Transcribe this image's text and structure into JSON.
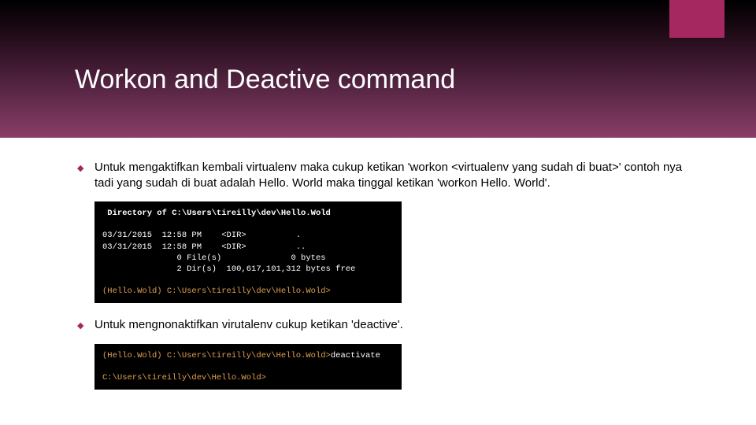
{
  "slide": {
    "title": "Workon and Deactive command"
  },
  "bullets": [
    {
      "text": "Untuk mengaktifkan kembali virtualenv maka cukup ketikan 'workon <virtualenv yang sudah di buat>' contoh nya tadi yang sudah di buat adalah Hello. World maka tinggal ketikan 'workon Hello. World'."
    },
    {
      "text": "Untuk mengnonaktifkan virutalenv cukup ketikan 'deactive'."
    }
  ],
  "terminal1": {
    "line1": " Directory of C:\\Users\\tireilly\\dev\\Hello.Wold",
    "line2": "03/31/2015  12:58 PM    <DIR>          .",
    "line3": "03/31/2015  12:58 PM    <DIR>          ..",
    "line4": "               0 File(s)              0 bytes",
    "line5": "               2 Dir(s)  100,617,101,312 bytes free",
    "prompt": "(Hello.Wold) C:\\Users\\tireilly\\dev\\Hello.Wold>"
  },
  "terminal2": {
    "line1_prompt": "(Hello.Wold) C:\\Users\\tireilly\\dev\\Hello.Wold>",
    "line1_cmd": "deactivate",
    "line2_prompt": "C:\\Users\\tireilly\\dev\\Hello.Wold>"
  },
  "colors": {
    "accent": "#a52860"
  }
}
